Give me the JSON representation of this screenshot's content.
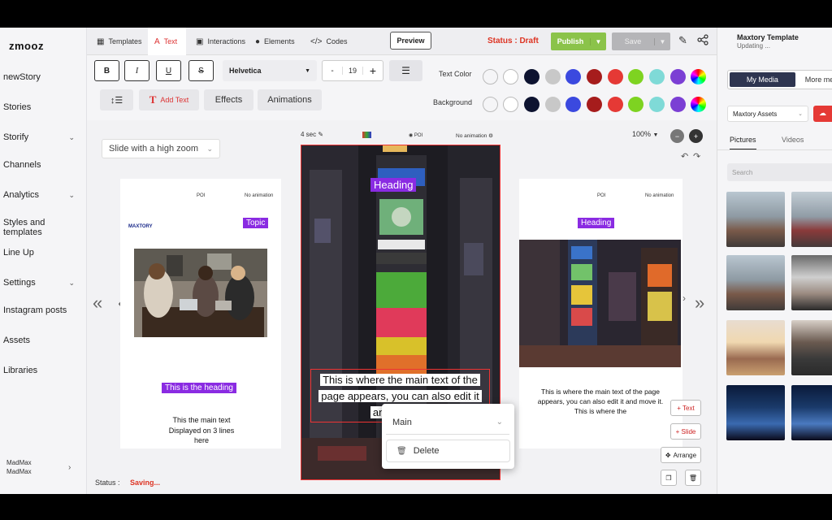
{
  "app": {
    "logo": "zmooz"
  },
  "sidebar": {
    "items": [
      {
        "label": "newStory",
        "chevron": false
      },
      {
        "label": "Stories",
        "chevron": false
      },
      {
        "label": "Storify",
        "chevron": true
      },
      {
        "label": "Channels",
        "chevron": false
      },
      {
        "label": "Analytics",
        "chevron": true
      },
      {
        "label": "Styles and templates",
        "chevron": false
      },
      {
        "label": "Line Up",
        "chevron": false
      },
      {
        "label": "Settings",
        "chevron": true
      },
      {
        "label": "Instagram posts",
        "chevron": false
      },
      {
        "label": "Assets",
        "chevron": false
      },
      {
        "label": "Libraries",
        "chevron": false
      }
    ],
    "user": {
      "name": "MadMax",
      "sub": "MadMax",
      "arrow": "›"
    }
  },
  "tabs": [
    {
      "label": "Templates",
      "icon": "▦"
    },
    {
      "label": "Text",
      "icon": "A"
    },
    {
      "label": "Interactions",
      "icon": "▣"
    },
    {
      "label": "Elements",
      "icon": "●"
    },
    {
      "label": "Codes",
      "icon": "</>"
    }
  ],
  "header": {
    "preview": "Preview",
    "status": "Status : Draft",
    "publish": "Publish",
    "save": "Save"
  },
  "toolbar": {
    "bold": "B",
    "italic": "I",
    "underline": "U",
    "strike": "S",
    "font": "Helvetica",
    "size": "19",
    "minus": "-",
    "plus": "+",
    "add_text": "Add Text",
    "effects": "Effects",
    "animations": "Animations",
    "text_color_label": "Text Color",
    "background_label": "Background",
    "colors": [
      "#f5f5f7",
      "#ffffff",
      "#0d1330",
      "#c8c8c8",
      "#3b49df",
      "#a61c1c",
      "#e53935",
      "#7ed321",
      "#7fdad7",
      "#7b3fd4"
    ]
  },
  "canvas": {
    "transition": "Slide with a high zoom",
    "duration": "4 sec",
    "poi": "POI",
    "no_animation": "No animation",
    "zoom": "100%",
    "left_card": {
      "brand": "MAXTORY",
      "topic": "Topic",
      "heading": "This is the heading",
      "body": "This the main text Displayed on 3 lines here"
    },
    "center_card": {
      "heading": "Heading",
      "body": "This is where the main text of the page appears, you can also edit it and move it"
    },
    "right_card": {
      "heading": "Heading",
      "body": "This is where the main text of the page appears, you can also edit it and move it. This is where the"
    },
    "actions": {
      "add_text": "+ Text",
      "add_slide": "+ Slide",
      "arrange": "Arrange"
    },
    "popup": {
      "select": "Main",
      "delete": "Delete"
    },
    "status_label": "Status :",
    "status_value": "Saving..."
  },
  "right_panel": {
    "title": "Maxtory Template",
    "subtitle": "Updating ...",
    "my_media": "My Media",
    "more_media": "More media",
    "assets": "Maxtory Assets",
    "tab_pictures": "Pictures",
    "tab_videos": "Videos",
    "search_placeholder": "Search"
  }
}
